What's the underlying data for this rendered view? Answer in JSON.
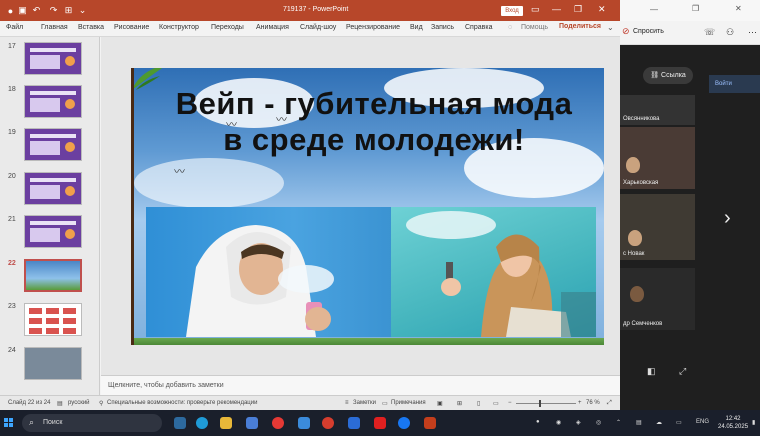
{
  "ppt": {
    "doc_title": "719137  -  PowerPoint",
    "login_label": "Вход",
    "tabs": [
      "Файл",
      "Главная",
      "Вставка",
      "Рисование",
      "Конструктор",
      "Переходы",
      "Анимация",
      "Слайд-шоу",
      "Рецензирование",
      "Вид",
      "Запись",
      "Справка"
    ],
    "help_search": "Помощь",
    "share_label": "Поделиться",
    "slide_numbers": [
      "17",
      "18",
      "19",
      "20",
      "21",
      "22",
      "23",
      "24"
    ],
    "current_slide": "22",
    "slide": {
      "title": "Вейп - губительная мода в среде молодежи!"
    },
    "notes_placeholder": "Щелкните, чтобы добавить заметки",
    "status": {
      "slide_counter": "Слайд 22 из 24",
      "language": "русский",
      "accessibility": "Специальные возможности: проверьте рекомендации",
      "notes_btn": "Заметки",
      "comments_btn": "Примечания",
      "zoom": "76 %"
    }
  },
  "meeting": {
    "ask_label": "Спросить",
    "link_label": "Ссылка",
    "blue_label": "Войти",
    "participants": [
      "Овсянникова",
      "Харьковская",
      "с Новак",
      "Семченков"
    ],
    "participants_suffix": [
      "ова",
      "",
      "",
      "др Семченков"
    ]
  },
  "taskbar": {
    "search_placeholder": "Поиск",
    "language": "ENG",
    "time": "12:42",
    "date": "24.05.2025"
  },
  "colors": {
    "ppt_accent": "#b7472a",
    "taskbar_bg": "#1a1f2b"
  }
}
